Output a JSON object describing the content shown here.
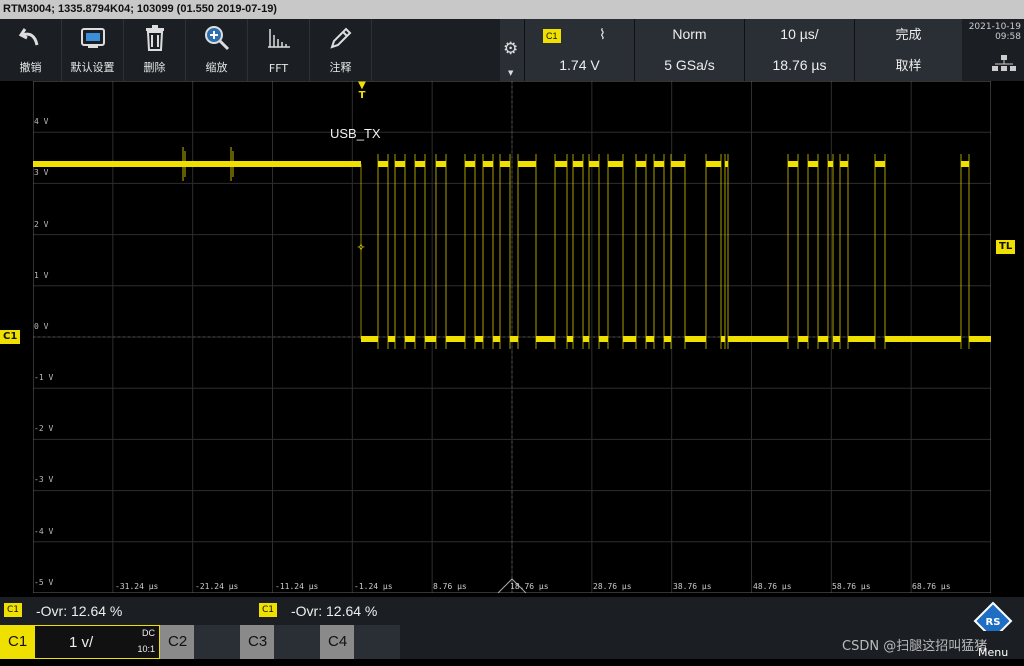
{
  "title": "RTM3004; 1335.8794K04; 103099 (01.550 2019-07-19)",
  "toolbar": [
    {
      "label": "撤销",
      "icon": "undo-icon"
    },
    {
      "label": "默认设置",
      "icon": "preset-icon"
    },
    {
      "label": "删除",
      "icon": "trash-icon"
    },
    {
      "label": "缩放",
      "icon": "zoom-icon"
    },
    {
      "label": "FFT",
      "icon": "fft-icon"
    },
    {
      "label": "注释",
      "icon": "pen-icon"
    }
  ],
  "trigger": {
    "source": "C1",
    "slope": "ʢ",
    "mode": "Norm",
    "timebase": "10 µs/",
    "status": "完成",
    "level": "1.74 V",
    "samplerate": "5 GSa/s",
    "position": "18.76 µs",
    "acq": "取样"
  },
  "clock": {
    "date": "2021-10-19",
    "time": "09:58"
  },
  "scope": {
    "signal_label": "USB_TX",
    "trigger_marker": "T",
    "ylabels": [
      "4 V",
      "3 V",
      "2 V",
      "1 V",
      "0 V",
      "-1 V",
      "-2 V",
      "-3 V",
      "-4 V",
      "-5 V"
    ],
    "xlabels": [
      "-31.24 µs",
      "-21.24 µs",
      "-11.24 µs",
      "-1.24 µs",
      "8.76 µs",
      "18.76 µs",
      "28.76 µs",
      "38.76 µs",
      "48.76 µs",
      "58.76 µs",
      "68.76 µs"
    ],
    "c1_tag": "C1",
    "tl_tag": "TL",
    "trace_color": "#f0e000"
  },
  "measure": [
    {
      "ch": "C1",
      "text": "-Ovr: 12.64 %"
    },
    {
      "ch": "C1",
      "text": "-Ovr: 12.64 %"
    }
  ],
  "channels": {
    "c1": {
      "label": "C1",
      "scale": "1 v/",
      "coupling": "DC",
      "probe": "10:1"
    },
    "c2": "C2",
    "c3": "C3",
    "c4": "C4"
  },
  "watermark": "CSDN @扫腿这招叫猛猪",
  "menu": "Menu"
}
